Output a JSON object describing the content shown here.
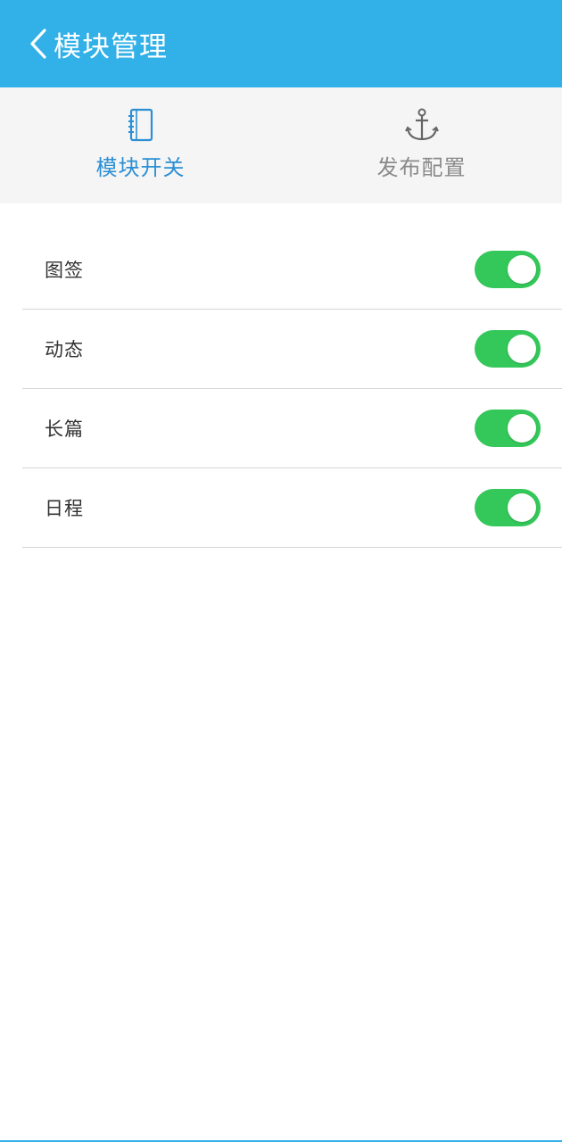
{
  "header": {
    "title": "模块管理",
    "back_icon": "chevron-left-icon"
  },
  "tabs": [
    {
      "label": "模块开关",
      "icon": "notebook-icon",
      "active": true
    },
    {
      "label": "发布配置",
      "icon": "anchor-icon",
      "active": false
    }
  ],
  "modules": [
    {
      "label": "图签",
      "enabled": true
    },
    {
      "label": "动态",
      "enabled": true
    },
    {
      "label": "长篇",
      "enabled": true
    },
    {
      "label": "日程",
      "enabled": true
    }
  ],
  "colors": {
    "header_bg": "#31b1e8",
    "tab_active": "#2b8fd4",
    "tab_inactive": "#8a8a8a",
    "toggle_on": "#34c759",
    "toggle_off": "#d0d0d0"
  }
}
